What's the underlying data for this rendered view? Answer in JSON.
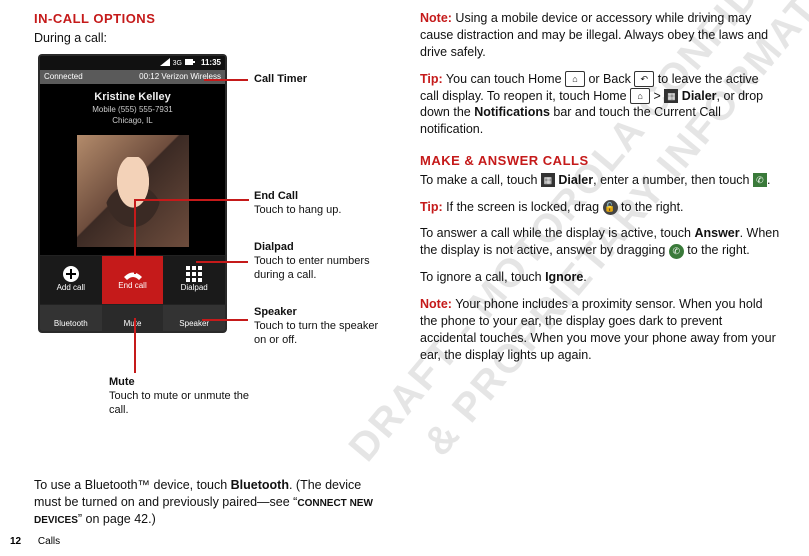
{
  "left": {
    "heading": "In-call options",
    "intro": "During a call:",
    "status_time": "11:35",
    "connected_left": "Connected",
    "connected_right": "00:12 Verizon Wireless",
    "caller_name": "Kristine Kelley",
    "caller_num": "Mobile (555) 555-7931",
    "caller_city": "Chicago, IL",
    "buttons": {
      "add": "Add call",
      "end": "End call",
      "dial": "Dialpad",
      "bt": "Bluetooth",
      "mute": "Mute",
      "spk": "Speaker"
    },
    "callouts": {
      "timer": "Call Timer",
      "endcall_t": "End Call",
      "endcall_b": "Touch to hang up.",
      "dialpad_t": "Dialpad",
      "dialpad_b": "Touch to enter numbers during a call.",
      "speaker_t": "Speaker",
      "speaker_b": "Touch to turn the speaker on or off.",
      "mute_t": "Mute",
      "mute_b": "Touch to mute or unmute the call."
    },
    "bottom_1a": "To use a Bluetooth™ device, touch ",
    "bottom_1b": "Bluetooth",
    "bottom_1c": ". (The device must be turned on and previously paired—see “",
    "bottom_xref": "Connect new devices",
    "bottom_1d": "” on page 42.)"
  },
  "right": {
    "note_label": "Note:",
    "note_text": " Using a mobile device or accessory while driving may cause distraction and may be illegal. Always obey the laws and drive safely.",
    "tip1_label": "Tip:",
    "tip1_a": " You can touch Home ",
    "tip1_b": " or Back ",
    "tip1_c": " to leave the active call display. To reopen it, touch Home ",
    "tip1_d": " > ",
    "tip1_dialer": " Dialer",
    "tip1_e": ", or drop down the ",
    "tip1_notif": "Notifications",
    "tip1_f": " bar and touch the Current Call notification.",
    "heading2": "Make & answer calls",
    "make_a": "To make a call, touch ",
    "make_dialer": " Dialer",
    "make_b": ", enter a number, then touch ",
    "make_c": ".",
    "tip2_label": "Tip:",
    "tip2_a": " If the screen is locked, drag ",
    "tip2_b": " to the right.",
    "answer_a": "To answer a call while the display is active, touch ",
    "answer_btn": "Answer",
    "answer_b": ". When the display is not active, answer by dragging ",
    "answer_c": " to the right.",
    "ignore_a": "To ignore a call, touch ",
    "ignore_btn": "Ignore",
    "ignore_b": ".",
    "note2_label": "Note:",
    "note2_text": " Your phone includes a proximity sensor. When you hold the phone to your ear, the display goes dark to prevent accidental touches. When you move your phone away from your ear, the display lights up again."
  },
  "footer": {
    "page": "12",
    "section": "Calls"
  }
}
